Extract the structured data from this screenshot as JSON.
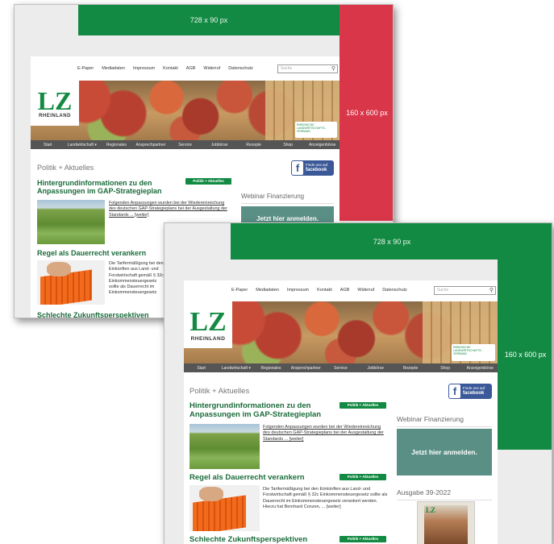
{
  "ads": {
    "leaderboard": "728 x 90 px",
    "skyscraper": "160 x 600 px"
  },
  "colors": {
    "brand_green": "#138a43",
    "ad_red": "#d9364a",
    "ad_green": "#138a43",
    "nav_gray": "#555555",
    "webinar_teal": "#5a8f85"
  },
  "topnav": [
    "E-Paper",
    "Mediadaten",
    "Impressum",
    "Kontakt",
    "AGB",
    "Widerruf",
    "Datenschutz"
  ],
  "search": {
    "placeholder": "Suche",
    "icon": "search-icon"
  },
  "logo": {
    "main": "LZ",
    "sub": "RHEINLAND"
  },
  "badge": {
    "line1": "RHEINISCHE",
    "line2": "LANDWIRTSCHAFTS-VERBAND"
  },
  "mainnav": [
    "Start",
    "Landwirtschaft ▾",
    "Regionales",
    "Ansprechpartner",
    "Service",
    "Jobbörse",
    "Rezepte",
    "Shop",
    "Anzeigenbörse"
  ],
  "section_title": "Politik + Aktuelles",
  "facebook": {
    "line1": "Finde uns auf",
    "line2": "facebook"
  },
  "articles": [
    {
      "title": "Hintergrundinformationen zu den Anpassungen im GAP-Strategieplan",
      "tag": "Politik + Aktuelles",
      "snippet": "Folgenden Anpassungen wurden bei der Wiedereinreichung des deutschen GAP-Strategieplans bei der Ausgestaltung der Standards ... [weiter]"
    },
    {
      "title": "Regel als Dauerrecht verankern",
      "tag": "Politik + Aktuelles",
      "snippet": "Die Tarifermäßigung bei den Einkünften aus Land- und Forstwirtschaft gemäß § 32c Einkommensteuergesetz sollte als Dauerrecht im Einkommensteuergesetz verankert werden. Hierzu hat Bernhard Conzen, ... [weiter]",
      "snippet_short": "Die Tarifermäßigung bei den Einkünften aus Land- und Forstwirtschaft gemäß § 32c Einkommensteuergesetz sollte als Dauerrecht im Einkommensteuergesetz verankert werden. Hierzu hat Bernhard Conzen, ... [weiter]"
    },
    {
      "title": "Schlechte Zukunftsperspektiven",
      "tag": "Politik + Aktuelles"
    }
  ],
  "sidebar": {
    "webinar_title": "Webinar Finanzierung",
    "webinar_button": "Jetzt hier anmelden.",
    "issue_title": "Ausgabe 39-2022"
  }
}
